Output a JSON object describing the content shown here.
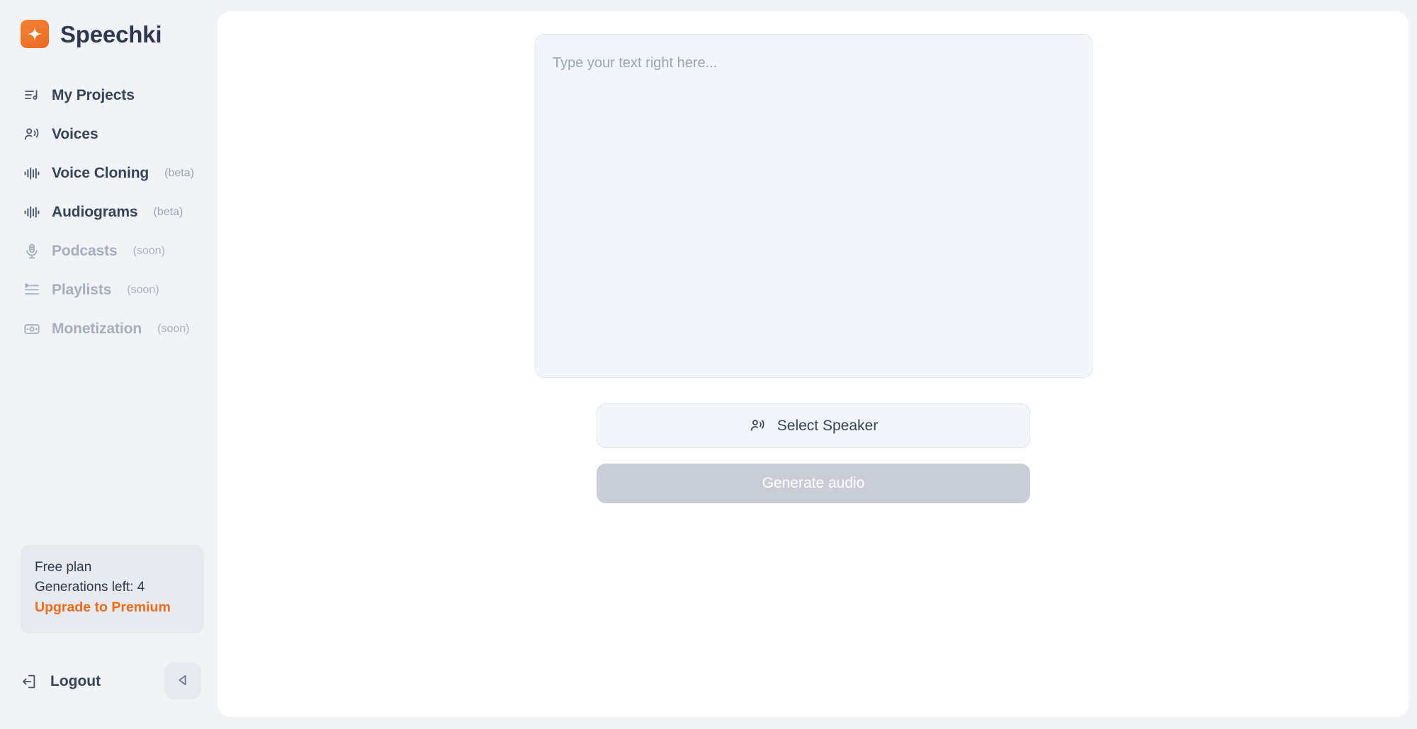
{
  "brand": {
    "name": "Speechki",
    "logo_icon": "sparkle-logo-icon",
    "accent_color": "#ef6c1f"
  },
  "sidebar": {
    "items": [
      {
        "id": "my-projects",
        "label": "My Projects",
        "tag": "",
        "icon": "list-music-icon",
        "state": "enabled"
      },
      {
        "id": "voices",
        "label": "Voices",
        "tag": "",
        "icon": "person-waves-icon",
        "state": "enabled"
      },
      {
        "id": "voice-cloning",
        "label": "Voice Cloning",
        "tag": "(beta)",
        "icon": "waveform-icon",
        "state": "enabled"
      },
      {
        "id": "audiograms",
        "label": "Audiograms",
        "tag": "(beta)",
        "icon": "waveform-icon",
        "state": "enabled"
      },
      {
        "id": "podcasts",
        "label": "Podcasts",
        "tag": "(soon)",
        "icon": "microphone-icon",
        "state": "soon"
      },
      {
        "id": "playlists",
        "label": "Playlists",
        "tag": "(soon)",
        "icon": "playlist-icon",
        "state": "soon"
      },
      {
        "id": "monetization",
        "label": "Monetization",
        "tag": "(soon)",
        "icon": "banknote-icon",
        "state": "soon"
      }
    ],
    "plan": {
      "name": "Free plan",
      "generations": "Generations left: 4",
      "upgrade_label": "Upgrade to Premium",
      "upgrade_color": "#ef6c1f"
    },
    "logout": {
      "label": "Logout",
      "icon": "logout-arrow-icon"
    },
    "collapse": {
      "icon": "collapse-left-triangle-icon"
    }
  },
  "main": {
    "editor": {
      "placeholder": "Type your text right here...",
      "value": ""
    },
    "select_speaker": {
      "label": "Select Speaker",
      "icon": "person-waves-icon"
    },
    "generate": {
      "label": "Generate audio",
      "disabled": true
    }
  }
}
